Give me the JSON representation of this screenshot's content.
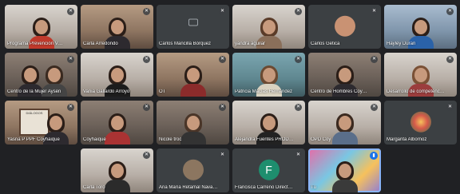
{
  "participants": [
    {
      "name": "Programa Prevención VCM C..."
    },
    {
      "name": "Carla Arredondo"
    },
    {
      "name": "Carlos Mancilla Bórquez"
    },
    {
      "name": "yandra aguilar"
    },
    {
      "name": "Carlos Getica"
    },
    {
      "name": "Hayley Duran"
    },
    {
      "name": "Centro de la Mujer Aysén"
    },
    {
      "name": "Vania Gallardo Arroyo"
    },
    {
      "name": "OT"
    },
    {
      "name": "Patricia Macías Hernández"
    },
    {
      "name": "Centro de Hombres Coyhaique"
    },
    {
      "name": "Desarrollo de competencias s..."
    },
    {
      "name": "Yasna P PPF Coyhaique"
    },
    {
      "name": "Coyhaique"
    },
    {
      "name": "Nicole troc"
    },
    {
      "name": "Alejandra Fuentes PRODEMU"
    },
    {
      "name": "OPD Coy"
    },
    {
      "name": "Margarita Albornoz"
    },
    {
      "name": "Carla Toro"
    },
    {
      "name": "Ana María Retamal Navarrete"
    },
    {
      "name": "Francisca Carreño Directora ..."
    },
    {
      "name": "Tú"
    }
  ],
  "poster_text": "DIÁLOGOS",
  "avatar_letter": "F",
  "mic_off_icon": "mic-off-icon",
  "colors": {
    "background": "#202124",
    "tile_dark": "#3c4043",
    "speaking": "#8ab4f8",
    "avatar_f": "#1e8e6e"
  }
}
